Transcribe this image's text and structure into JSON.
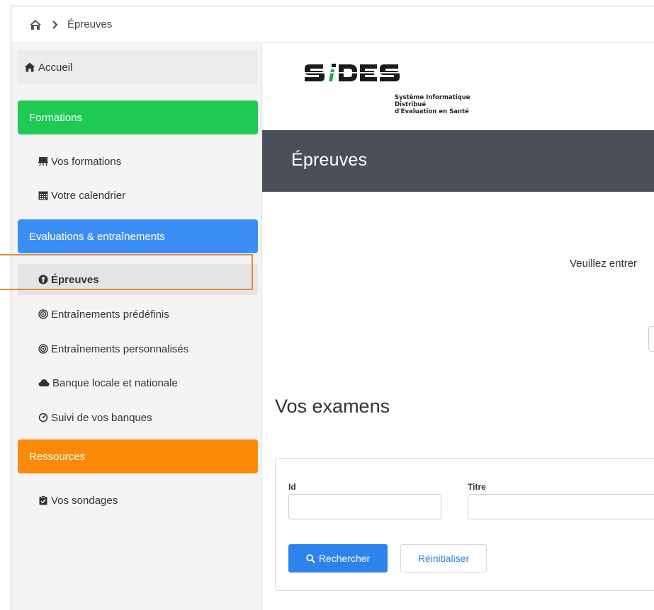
{
  "breadcrumb": {
    "home_icon": "home-icon",
    "separator_icon": "chevron-right-icon",
    "current": "Épreuves"
  },
  "sidebar": {
    "home_label": "Accueil",
    "sections": {
      "formations": {
        "label": "Formations",
        "color": "#1fca54"
      },
      "evaluations": {
        "label": "Evaluations & entraînements",
        "color": "#3d8ef4"
      },
      "ressources": {
        "label": "Ressources",
        "color": "#fb8a06"
      }
    },
    "items": [
      {
        "label": "Vos formations",
        "icon": "presentation-icon"
      },
      {
        "label": "Votre calendrier",
        "icon": "calendar-icon"
      },
      {
        "label": "Épreuves",
        "icon": "exam-icon",
        "active": true
      },
      {
        "label": "Entraînements prédéfinis",
        "icon": "target-icon"
      },
      {
        "label": "Entraînements personnalisés",
        "icon": "target-icon"
      },
      {
        "label": "Banque locale et nationale",
        "icon": "cloud-icon"
      },
      {
        "label": "Suivi de vos banques",
        "icon": "dashboard-icon"
      },
      {
        "label": "Vos sondages",
        "icon": "clipboard-icon"
      }
    ]
  },
  "logo": {
    "text": "SIDES",
    "subtitle_line1": "Système Informatique Distribué",
    "subtitle_line2": "d'Evaluation en Santé"
  },
  "page": {
    "title": "Épreuves",
    "notice": "Veuillez entrer",
    "section_title": "Vos examens"
  },
  "search_form": {
    "id_label": "Id",
    "title_label": "Titre",
    "id_value": "",
    "title_value": "",
    "search_button": "Rechercher",
    "reset_button": "Réinitialiser"
  },
  "colors": {
    "accent_blue": "#2c83ec",
    "banner": "#4c4f59",
    "highlight": "#e48a3c"
  }
}
